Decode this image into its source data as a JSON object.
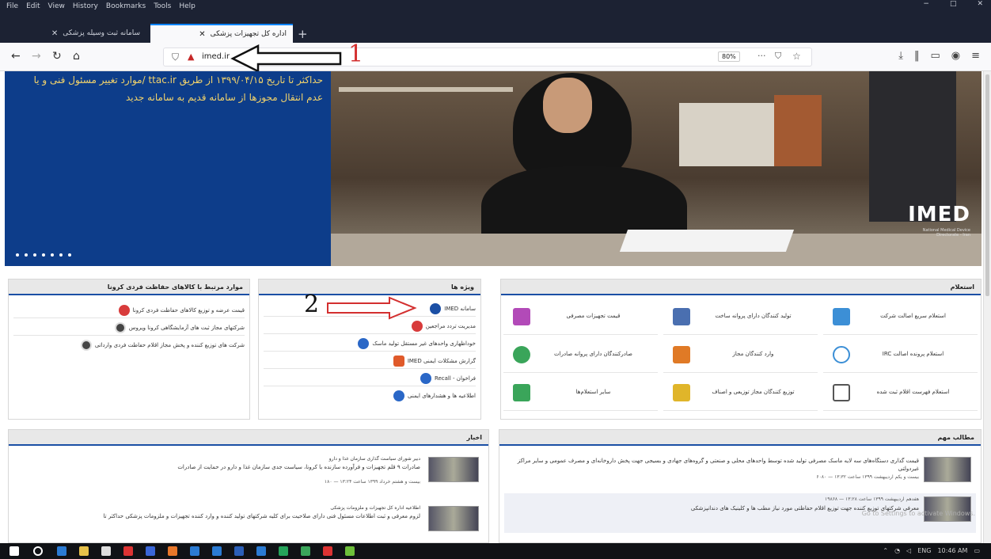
{
  "browser": {
    "menu": [
      "File",
      "Edit",
      "View",
      "History",
      "Bookmarks",
      "Tools",
      "Help"
    ],
    "window_controls": [
      "−",
      "□",
      "✕"
    ],
    "tabs": [
      {
        "label": "سامانه ثبت وسیله پزشکی",
        "active": false
      },
      {
        "label": "اداره کل تجهیزات پزشکی",
        "active": true
      }
    ],
    "new_tab": "+",
    "url": "imed.ir",
    "zoom": "80%",
    "more": "···"
  },
  "annotations": {
    "arrow1_number": "1",
    "arrow2_number": "2"
  },
  "hero": {
    "text": "حداکثر تا تاریخ ۱۳۹۹/۰۴/۱۵ از طریق ttac.ir /موارد تغییر مسئول فنی و یا عدم انتقال مجوزها از سامانه قدیم به سامانه جدید",
    "logo": "IMED",
    "logo_sub": "National Medical Device Directorate - Iran"
  },
  "corona_box": {
    "title": "موارد مرتبط با کالاهای حفاظت فردی کرونا",
    "items": [
      "قیمت عرضه و توزیع کالاهای حفاظت فردی کرونا",
      "شرکتهای مجاز ثبت های آزمایشگاهی کرونا ویروس",
      "شرکت های توزیع کننده و پخش مجاز اقلام حفاظت فردی وارداتی"
    ]
  },
  "special_box": {
    "title": "ویژه ها",
    "items": [
      "سامانه IMED",
      "مدیریت تردد مراجعین",
      "خوداظهاری واحدهای غیر مستقل تولید ماسک",
      "گزارش مشکلات ایمنی IMED",
      "فراخوان - Recall",
      "اطلاعیه ها و هشدارهای ایمنی"
    ]
  },
  "inquiry_box": {
    "title": "استعلام",
    "cells": [
      "استعلام سریع اصالت شرکت",
      "تولید کنندگان دارای پروانه ساخت",
      "قیمت تجهیزات مصرفی",
      "استعلام پرونده اصالت IRC",
      "وارد کنندگان مجاز",
      "صادرکنندگان دارای پروانه صادرات",
      "استعلام فهرست اقلام ثبت شده",
      "توزیع کنندگان مجاز توزیعی و اصناف",
      "سایر استعلام‌ها"
    ]
  },
  "news_box": {
    "title": "اخبار",
    "items": [
      {
        "kicker": "دبیر شورای سیاست گذاری سازمان غذا و دارو",
        "text": "صادرات ۹ قلم تجهیزات و فرآورده سازنده با کرونا، سیاست جدی سازمان غذا و دارو در حمایت از صادرات",
        "meta": "بیست و هشتم خرداد ۱۳۹۹ ساعت ۱۳:۲۴ — ۱۸۰"
      },
      {
        "kicker": "اطلاعیه اداره کل تجهیزات و ملزومات پزشکی",
        "text": "لزوم معرفی و ثبت اطلاعات مسئول فنی دارای صلاحیت برای کلیه شرکتهای تولید کننده و وارد کننده تجهیزات و ملزومات پزشکی حداکثر تا",
        "meta": ""
      }
    ]
  },
  "important_box": {
    "title": "مطالب مهم",
    "items": [
      {
        "text": "قیمت گذاری دستگاه‌های سه لایه ماسک مصرفی تولید شده توسط واحدهای محلی و صنعتی و گروه‌های جهادی و بسیجی جهت پخش داروخانه‌ای و مصرف عمومی و سایر مراکز غیردولتی",
        "meta": "بیست و یکم اردیبهشت ۱۳۹۹ ساعت ۱۳:۳۲ — ۶۰۸۰"
      },
      {
        "text": "معرفی شرکتهای توزیع کننده جهت توزیع اقلام حفاظتی مورد نیاز مطب ها و کلینیک های دندانپزشکی",
        "meta": "هفدهم اردیبهشت ۱۳۹۹ ساعت ۱۳:۲۸ — ۱۹۸۶۸"
      }
    ]
  },
  "watermark": "Go to Settings to activate Windows.",
  "taskbar": {
    "tray": [
      "ENG",
      "10:46 AM"
    ]
  },
  "colors": {
    "dark_chrome": "#1c2233",
    "hero_blue": "#0d3d8a",
    "hero_text": "#f2d36b",
    "accent_line": "#1b4fa5",
    "annotation_red": "#d32f2f"
  }
}
